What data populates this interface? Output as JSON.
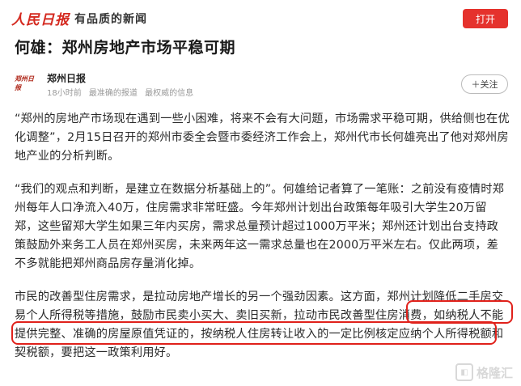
{
  "header": {
    "logo_text": "人民日报",
    "slogan": "有品质的新闻",
    "open_button": "打开"
  },
  "article": {
    "title": "何雄：郑州房地产市场平稳可期",
    "author": {
      "name": "郑州日报",
      "avatar_text": "郑州日报",
      "time": "18小时前",
      "tagline_1": "最准确的报道",
      "tagline_2": "最权威的信息",
      "follow_button": "＋关注"
    },
    "paragraphs": [
      "“郑州的房地产市场现在遇到一些小困难，将来不会有大问题，市场需求平稳可期，供给侧也在优化调整”，2月15日召开的郑州市委全会暨市委经济工作会上，郑州代市长何雄亮出了他对郑州房地产业的分析判断。",
      "“我们的观点和判断，是建立在数据分析基础上的”。何雄给记者算了一笔账：之前没有疫情时郑州每年人口净流入40万，住房需求非常旺盛。今年郑州计划出台政策每年吸引大学生20万留郑，这些留郑大学生如果三年内买房，需求总量预计超过1000万平米；郑州还计划出台支持政策鼓励外来务工人员在郑州买房，未来两年这一需求总量也在2000万平米左右。仅此两项，差不多就能把郑州商品房存量消化掉。",
      "市民的改善型住房需求，是拉动房地产增长的另一个强劲因素。这方面，郑州计划降低二手房交易个人所得税等措施，鼓励市民卖小买大、卖旧买新，拉动市民改善型住房消费，如纳税人不能提供完整、准确的房屋原值凭证的，按纳税人住房转让收入的一定比例核定应纳个人所得税额和契税额，要把这一政策利用好。"
    ]
  },
  "watermark": {
    "icon": "gelonghui-icon",
    "text": "格隆汇"
  },
  "colors": {
    "brand_red": "#e5322d",
    "highlight_red": "#e0211b"
  }
}
